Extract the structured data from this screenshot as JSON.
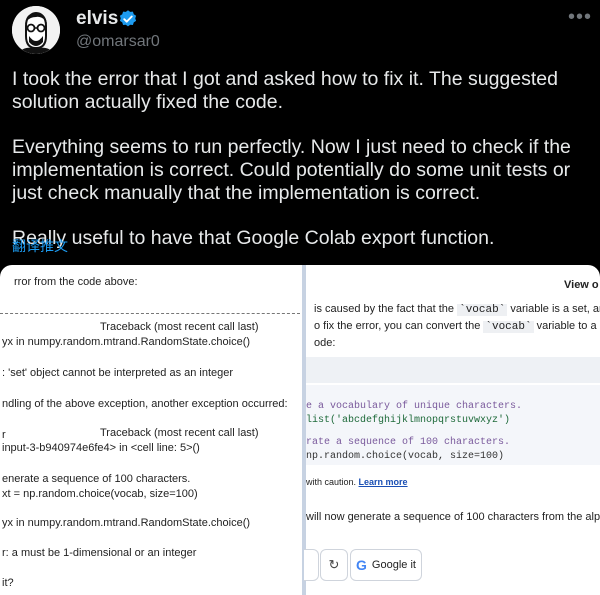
{
  "author": {
    "name": "elvis",
    "handle": "@omarsar0"
  },
  "tweet": {
    "paragraphs": [
      "I took the error that I got and asked how to fix it. The suggested solution actually fixed the code.",
      "Everything seems to run perfectly. Now I just need to check if the implementation is correct. Could potentially do some unit tests or just check manually that the implementation is correct.",
      "Really useful to have that Google Colab export function."
    ],
    "translate": "翻译推文"
  },
  "left_panel": {
    "lines": [
      "rror from the code above:",
      "Traceback (most recent call last)",
      "yx in numpy.random.mtrand.RandomState.choice()",
      ": 'set' object cannot be interpreted as an integer",
      "ndling of the above exception, another exception occurred:",
      "r",
      "Traceback (most recent call last)",
      "input-3-b940974e6fe4> in <cell line: 5>()",
      "enerate a sequence of 100 characters.",
      "xt = np.random.choice(vocab, size=100)",
      "yx in numpy.random.mtrand.RandomState.choice()",
      "r: a must be 1-dimensional or an integer",
      "it?"
    ]
  },
  "right_panel": {
    "view_other": "View o",
    "line1_a": "is caused by the fact that the ",
    "line1_code": "`vocab`",
    "line1_b": " variable is a set, and s",
    "line2_a": "o fix the error, you can convert the ",
    "line2_code": "`vocab`",
    "line2_b": " variable to a list.",
    "line3": "ode:",
    "code_lines": [
      "e a vocabulary of unique characters.",
      "list('abcdefghijklmnopqrstuvwxyz')",
      "rate a sequence of 100 characters.",
      "np.random.choice(vocab, size=100)"
    ],
    "caution": "with caution. ",
    "learn_more": "Learn more",
    "bottom_text": "will now generate a sequence of 100 characters from the alph",
    "google_it": "Google it"
  }
}
